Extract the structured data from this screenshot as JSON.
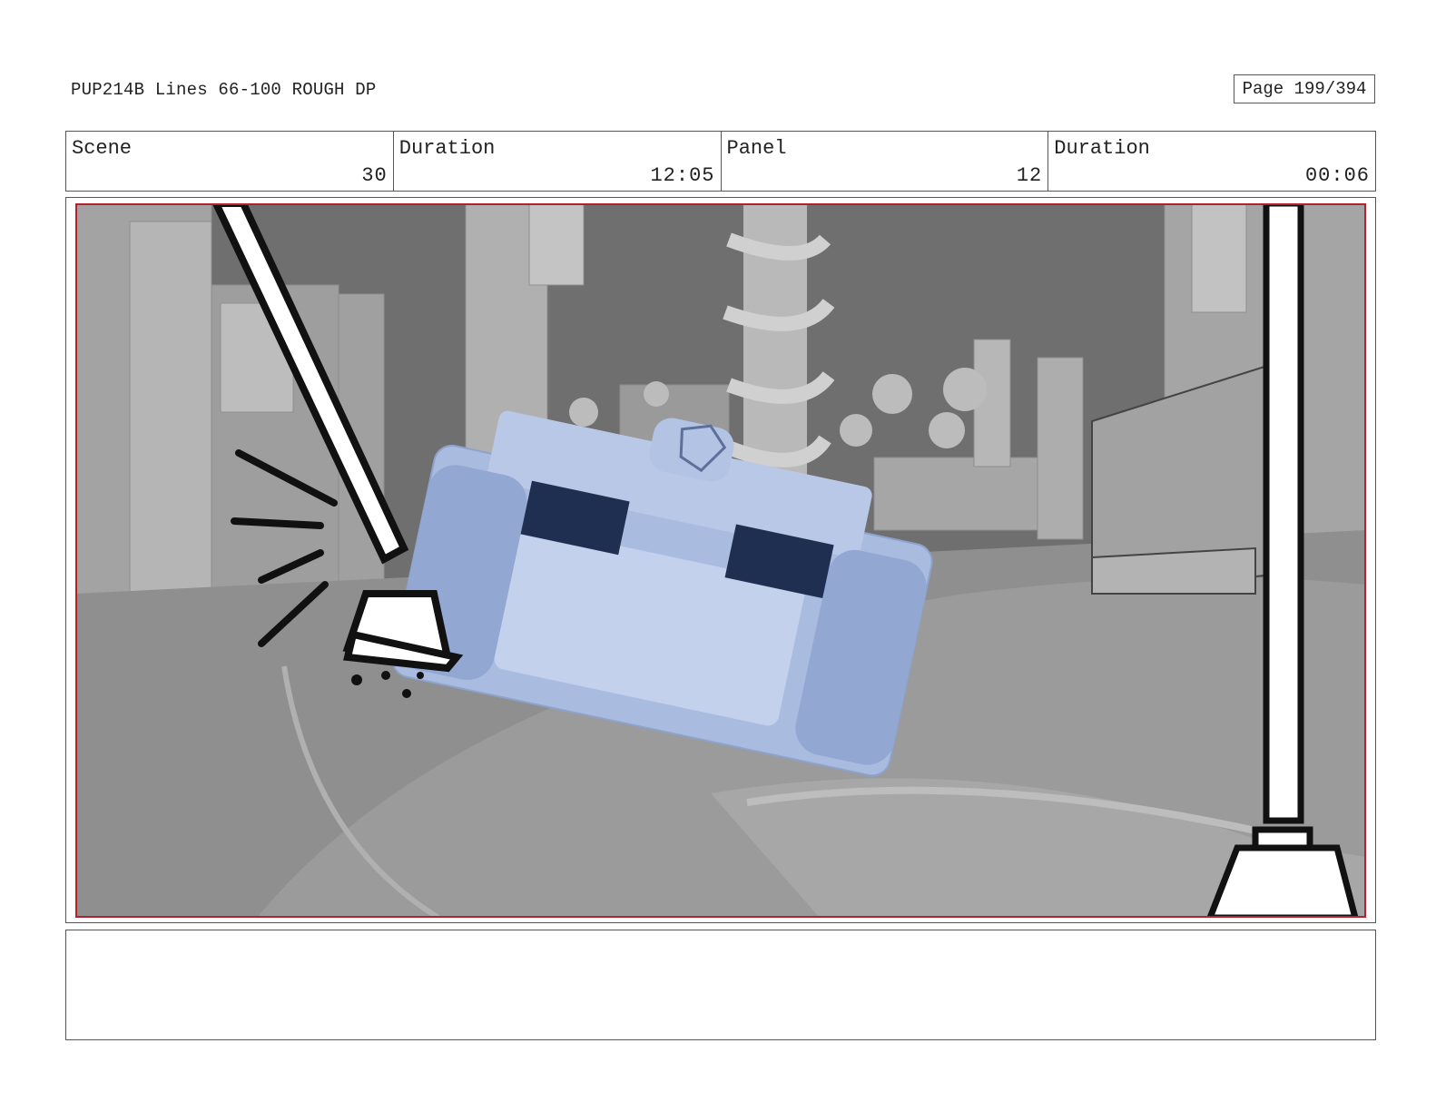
{
  "header": {
    "title": "PUP214B Lines 66-100 ROUGH DP",
    "page": "Page 199/394"
  },
  "info": {
    "scene_label": "Scene",
    "scene_value": "30",
    "scene_duration_label": "Duration",
    "scene_duration_value": "12:05",
    "panel_label": "Panel",
    "panel_value": "12",
    "panel_duration_label": "Duration",
    "panel_duration_value": "00:06"
  },
  "panel": {
    "image_description_icon": "storyboard-frame",
    "safe_area_color": "#b3222c",
    "vehicle_color": "#b8c8e6"
  },
  "notes": {
    "text": ""
  }
}
